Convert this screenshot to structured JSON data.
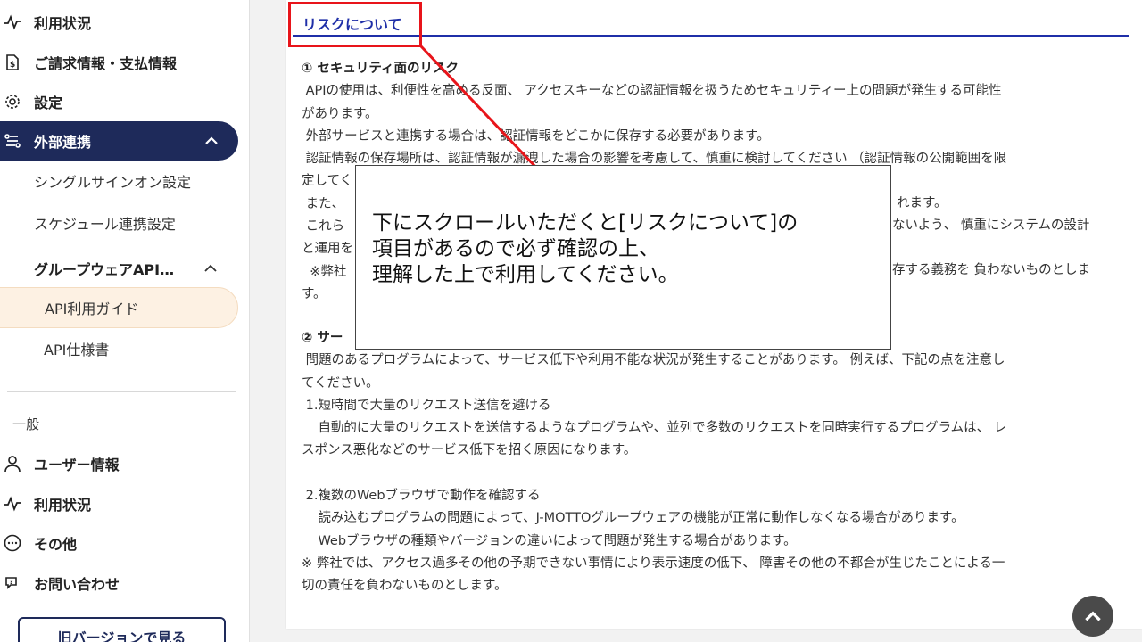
{
  "sidebar": {
    "items_top": [
      {
        "label": "利用状況",
        "icon": "activity-icon"
      },
      {
        "label": "ご請求情報・支払情報",
        "icon": "invoice-icon"
      },
      {
        "label": "設定",
        "icon": "gear-icon"
      }
    ],
    "active": {
      "label": "外部連携",
      "icon": "integration-icon"
    },
    "sub_items": {
      "sso": "シングルサインオン設定",
      "schedule": "スケジュール連携設定",
      "groupware_api": "グループウェアAPI…",
      "api_guide": "API利用ガイド",
      "api_spec": "API仕様書"
    },
    "section_general": "一般",
    "items_general": [
      {
        "label": "ユーザー情報",
        "icon": "user-icon"
      },
      {
        "label": "利用状況",
        "icon": "activity-icon"
      },
      {
        "label": "その他",
        "icon": "more-icon"
      },
      {
        "label": "お問い合わせ",
        "icon": "contact-icon"
      }
    ],
    "old_version_button": "旧バージョンで見る"
  },
  "main": {
    "section_title": "リスクについて",
    "body": {
      "l1": "① セキュリティ面のリスク",
      "l2": " APIの使用は、利便性を高める反面、 アクセスキーなどの認証情報を扱うためセキュリティー上の問題が発生する可能性",
      "l3": "があります。",
      "l4": " 外部サービスと連携する場合は、認証情報をどこかに保存する必要があります。",
      "l5": " 認証情報の保存場所は、認証情報が漏洩した場合の影響を考慮して、慎重に検討してください （認証情報の公開範囲を限",
      "l6": "定してく",
      "l7": " また、",
      "l7b": "れます。",
      "l8": " これら",
      "l8b": "ないよう、 慎重にシステムの設計",
      "l9": "と運用を",
      "l10": "  ※弊社",
      "l10b": "存する義務を 負わないものとしま",
      "l11": "す。",
      "l12": "② サー",
      "l13": " 問題のあるプログラムによって、サービス低下や利用不能な状況が発生することがあります。 例えば、下記の点を注意し",
      "l14": "てください。",
      "l15": " 1.短時間で大量のリクエスト送信を避ける",
      "l16": "    自動的に大量のリクエストを送信するようなプログラムや、並列で多数のリクエストを同時実行するプログラムは、 レ",
      "l17": "スポンス悪化などのサービス低下を招く原因になります。",
      "l18": " 2.複数のWebブラウザで動作を確認する",
      "l19": "    読み込むプログラムの問題によって、J-MOTTOグループウェアの機能が正常に動作しなくなる場合があります。",
      "l20": "    Webブラウザの種類やバージョンの違いによって問題が発生する場合があります。",
      "l21": "※ 弊社では、アクセス過多その他の予期できない事情により表示速度の低下、 障害その他の不都合が生じたことによる一",
      "l22": "切の責任を負わないものとします。"
    }
  },
  "callout": {
    "line1": "下にスクロールいただくと[リスクについて]の",
    "line2": "項目があるので必ず確認の上、",
    "line3": "理解した上で利用してください。"
  },
  "colors": {
    "nav_active_bg": "#1e2a5a",
    "title_blue": "#1f2fa8",
    "highlight_red": "#e8141a",
    "guide_bg": "#fdf1e3"
  }
}
